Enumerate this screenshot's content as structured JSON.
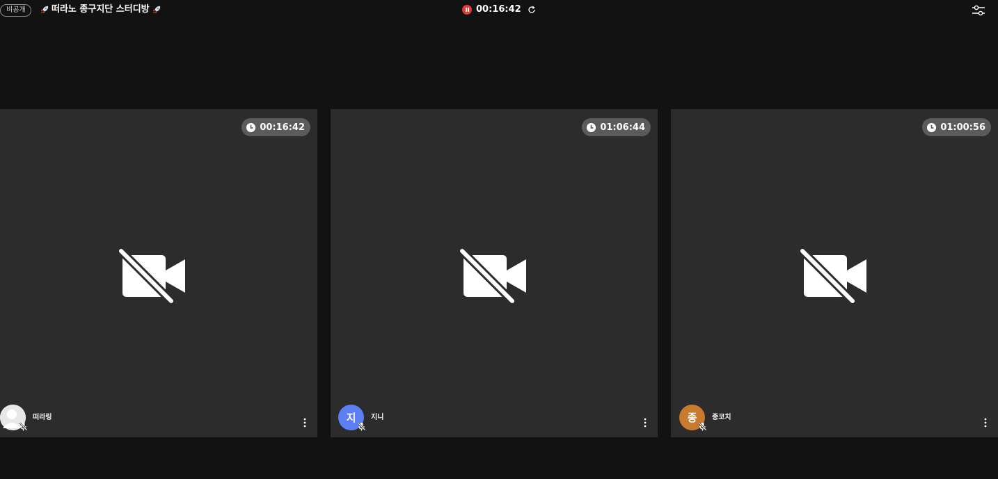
{
  "header": {
    "privacy_label": "비공개",
    "room_title": "떠라노 종구지단 스터디방",
    "elapsed_time": "00:16:42",
    "icons": {
      "privacy": "badge",
      "title_decoration": "rocket-icon",
      "pause": "pause-icon",
      "refresh": "refresh-icon",
      "settings": "settings-sliders-icon"
    }
  },
  "participants": [
    {
      "name": "떠라링",
      "study_time": "00:16:42",
      "avatar_type": "photo",
      "avatar_initial": "",
      "avatar_color": "#e8e8e8",
      "camera": "off",
      "mic": "off"
    },
    {
      "name": "지니",
      "study_time": "01:06:44",
      "avatar_type": "initial",
      "avatar_initial": "지",
      "avatar_color": "#5b7ff3",
      "camera": "off",
      "mic": "off"
    },
    {
      "name": "종코치",
      "study_time": "01:00:56",
      "avatar_type": "initial",
      "avatar_initial": "종",
      "avatar_color": "#c87a2e",
      "camera": "off",
      "mic": "off"
    }
  ],
  "colors": {
    "background": "#121212",
    "tile": "#2c2c2c",
    "time_chip": "#5b5b5b",
    "recording": "#e53935"
  }
}
